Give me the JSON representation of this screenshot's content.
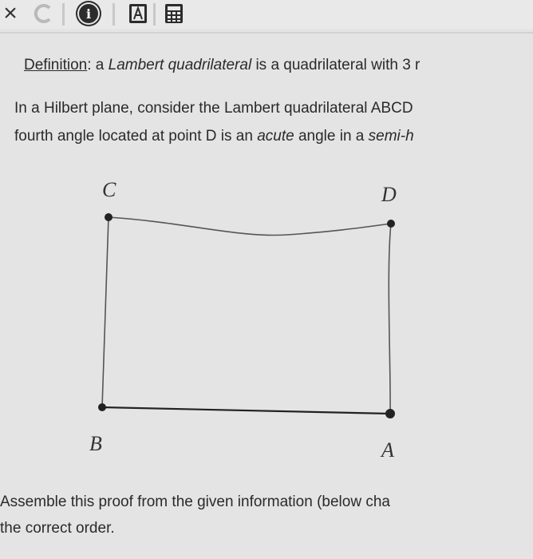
{
  "toolbar": {
    "close_glyph": "×",
    "icons": [
      "close-icon",
      "refresh-icon",
      "info-icon",
      "text-icon",
      "calculator-icon"
    ]
  },
  "text": {
    "def_label": "Definition",
    "def_colon": ": a ",
    "def_term": "Lambert quadrilateral",
    "def_rest": " is a quadrilateral with 3 r",
    "p1": "In a Hilbert plane, consider the Lambert quadrilateral ABCD",
    "p2_a": "fourth angle located at point D is an ",
    "p2_acute": "acute",
    "p2_b": " angle in a ",
    "p2_semi": "semi-h"
  },
  "diagram": {
    "labels": {
      "C": "C",
      "D": "D",
      "B": "B",
      "A": "A"
    }
  },
  "bottom": {
    "line1": "Assemble this proof from the given information (below cha",
    "line2": "the correct order."
  },
  "colors": {
    "background": "#e4e4e4",
    "text": "#2a2a2a",
    "ink": "#222222"
  }
}
